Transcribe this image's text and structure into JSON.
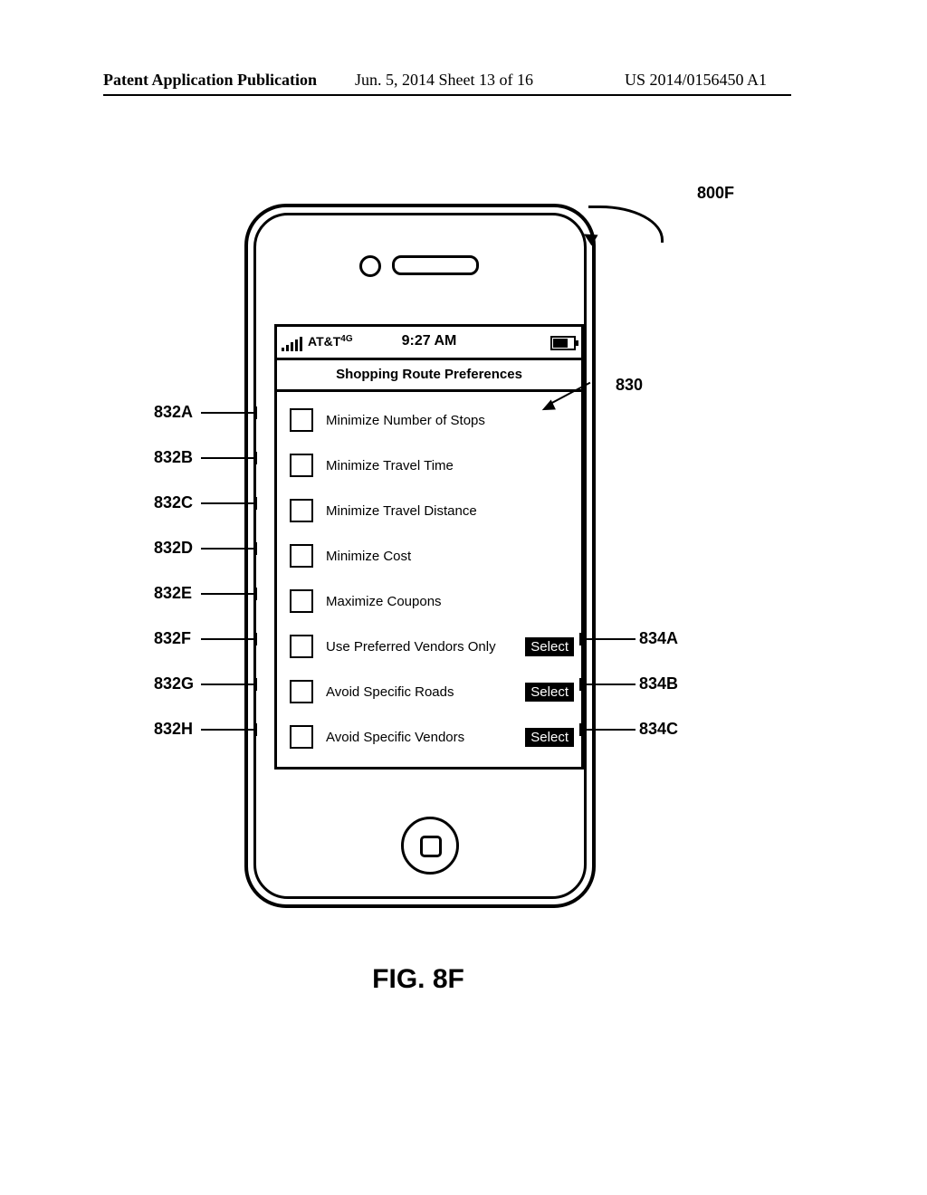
{
  "header": {
    "left": "Patent Application Publication",
    "center": "Jun. 5, 2014  Sheet 13 of 16",
    "right": "US 2014/0156450 A1"
  },
  "figure_caption": "FIG. 8F",
  "phone": {
    "status": {
      "carrier": "AT&T",
      "network": "4G",
      "time": "9:27 AM"
    },
    "screen_title": "Shopping Route Preferences",
    "rows": [
      {
        "label": "Minimize Number of Stops",
        "select": false
      },
      {
        "label": "Minimize Travel Time",
        "select": false
      },
      {
        "label": "Minimize Travel Distance",
        "select": false
      },
      {
        "label": "Minimize Cost",
        "select": false
      },
      {
        "label": "Maximize Coupons",
        "select": false
      },
      {
        "label": "Use Preferred Vendors Only",
        "select": true
      },
      {
        "label": "Avoid Specific Roads",
        "select": true
      },
      {
        "label": "Avoid Specific Vendors",
        "select": true
      }
    ],
    "select_button_label": "Select"
  },
  "callouts": {
    "top_right": "800F",
    "content_area": "830",
    "left": [
      "832A",
      "832B",
      "832C",
      "832D",
      "832E",
      "832F",
      "832G",
      "832H"
    ],
    "right": [
      "834A",
      "834B",
      "834C"
    ]
  }
}
